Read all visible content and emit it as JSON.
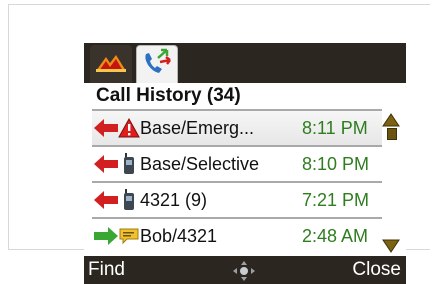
{
  "header": {
    "title": "Call History (34)"
  },
  "tabs": [
    {
      "name": "alerts",
      "icon": "alert-bars-icon",
      "active": false
    },
    {
      "name": "call-history",
      "icon": "phone-arrows-icon",
      "active": true
    }
  ],
  "calls": [
    {
      "direction": "incoming",
      "direction_icon": "incoming-arrow-icon",
      "type_icon": "emergency-warning-icon",
      "name": "Base/Emerg...",
      "time": "8:11 PM"
    },
    {
      "direction": "incoming",
      "direction_icon": "incoming-arrow-icon",
      "type_icon": "radio-handset-icon",
      "name": "Base/Selective",
      "time": "8:10 PM"
    },
    {
      "direction": "incoming",
      "direction_icon": "incoming-arrow-icon",
      "type_icon": "radio-handset-icon",
      "name": "4321 (9)",
      "time": "7:21 PM"
    },
    {
      "direction": "outgoing",
      "direction_icon": "outgoing-arrow-icon",
      "type_icon": "message-icon",
      "name": "Bob/4321",
      "time": "2:48 AM"
    }
  ],
  "softkeys": {
    "left": "Find",
    "right": "Close",
    "center_icon": "navigation-pad-icon"
  },
  "colors": {
    "bar": "#2b2620",
    "incoming_arrow": "#d21f1f",
    "outgoing_arrow": "#3aa634",
    "time_text": "#2e7d1f",
    "scroll": "#6b5410"
  }
}
